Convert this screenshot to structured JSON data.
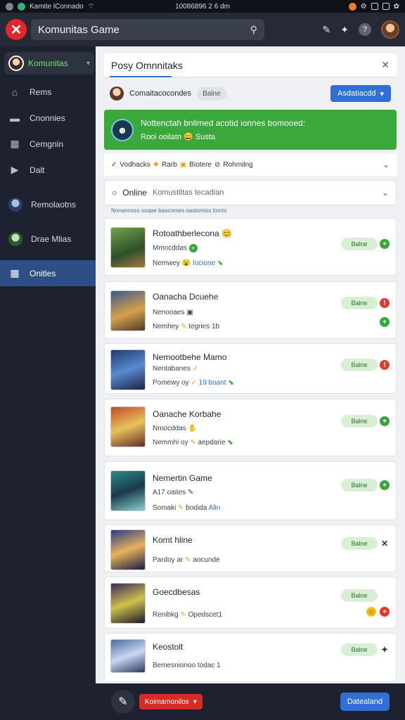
{
  "statusbar": {
    "left": "Kamite lConnado",
    "time": "10086896 2 6 dm"
  },
  "topbar": {
    "search_value": "Komunitas Game"
  },
  "sidebar": {
    "header_label": "Komunitas",
    "items": [
      {
        "label": "Rems",
        "icon": "home-icon"
      },
      {
        "label": "Cnonnies",
        "icon": "folder-icon"
      },
      {
        "label": "Cemgnin",
        "icon": "grid-icon"
      },
      {
        "label": "Dalt",
        "icon": "play-icon"
      },
      {
        "label": "Remolaotns",
        "icon": "avatar-icon"
      },
      {
        "label": "Drae Mlias",
        "icon": "avatar-icon"
      },
      {
        "label": "Onitles",
        "icon": "grid-icon"
      }
    ]
  },
  "panel": {
    "title": "Posy Omnnitaks"
  },
  "filter": {
    "label": "Comaitacocondes",
    "chip": "Balne",
    "button": "Asdatiacdd"
  },
  "banner": {
    "title": "Nottenctah bnlimed acotid ionnes bomooed:",
    "sub_left": "Rooi ooilatn",
    "sub_right": "Susta"
  },
  "tags": {
    "t1": "Vodhacks",
    "t2": "Rarb",
    "t3": "Biotere",
    "t4": "Rohmilng"
  },
  "search_row": {
    "label": "Online",
    "placeholder": "Komustiltas tecadian"
  },
  "hint": "Nonannoss ooqae baocomes oaoiomiss tomts",
  "cards": [
    {
      "title": "Rotoathberlecona",
      "line2": "Mmocddas",
      "line3": "Nemwey",
      "link": "Iocione",
      "status": "Balne"
    },
    {
      "title": "Oanacha Dcuehe",
      "line2": "Nenooaes",
      "line3": "Nemhey",
      "link": "tegries 1b",
      "status": "Balne"
    },
    {
      "title": "Nemootbehe Mamo",
      "line2": "Nentabanes",
      "line3": "Pomewy oy",
      "link": "19 boant",
      "status": "Balne"
    },
    {
      "title": "Oanache Korbahe",
      "line2": "Nmocddas",
      "line3": "Nemmhi oy",
      "link": "aepdarie",
      "status": "Balne"
    },
    {
      "title": "Nemertin Game",
      "line2": "A17 oaites",
      "line3": "Somaki",
      "link": "Alin",
      "status": "Balne"
    },
    {
      "title": "Komt hline",
      "line2": "",
      "line3": "Pardoy ar",
      "link": "aocunde",
      "status": "Balne"
    },
    {
      "title": "Goecdbesas",
      "line2": "",
      "line3": "Renibkg",
      "link": "Opedscet1",
      "status": "Balne"
    },
    {
      "title": "Keostolt",
      "line2": "",
      "line3": "Bemesnionoo todac 1",
      "link": "",
      "status": "Balne"
    }
  ],
  "bottombar": {
    "red_button": "Koimamonilos",
    "save_button": "Datealand"
  },
  "colors": {
    "accent": "#2f6fd6",
    "success": "#3aa83a",
    "danger": "#e2262c",
    "sidebar": "#1e2230"
  }
}
